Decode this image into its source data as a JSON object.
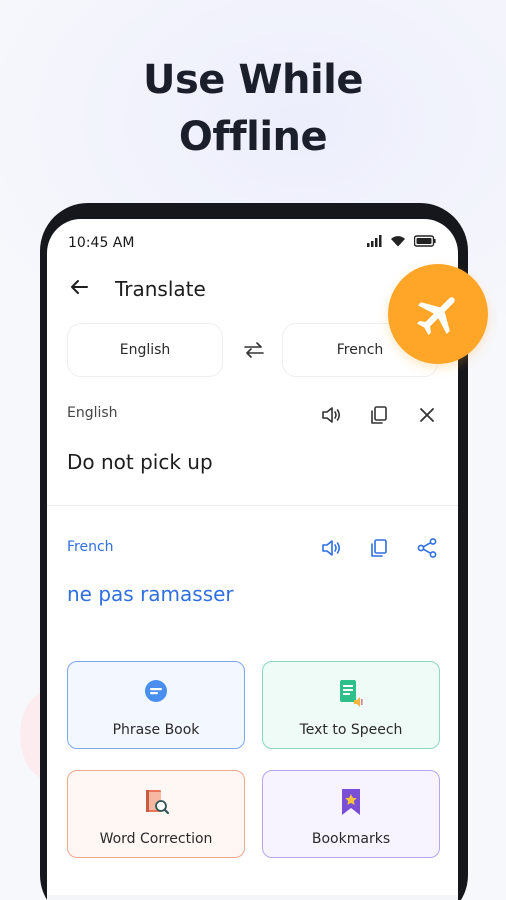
{
  "promo": {
    "headline_line1": "Use While",
    "headline_line2": "Offline"
  },
  "status_bar": {
    "time": "10:45 AM"
  },
  "header": {
    "title": "Translate"
  },
  "languages": {
    "source": "English",
    "target": "French"
  },
  "source_panel": {
    "label": "English",
    "text": "Do not pick up"
  },
  "target_panel": {
    "label": "French",
    "text": "ne pas ramasser"
  },
  "features": [
    {
      "label": "Phrase Book",
      "icon": "chat-bubble-icon"
    },
    {
      "label": "Text to Speech",
      "icon": "document-speaker-icon"
    },
    {
      "label": "Word Correction",
      "icon": "book-magnifier-icon"
    },
    {
      "label": "Bookmarks",
      "icon": "bookmark-star-icon"
    }
  ],
  "colors": {
    "accent_blue": "#2f6fe0",
    "badge_orange": "#ffa629",
    "phrase_border": "#7fa6ec",
    "tts_border": "#8ad7c2",
    "word_border": "#f0a88e",
    "bookmarks_border": "#b5a5ec"
  },
  "badge": {
    "icon": "airplane-icon"
  }
}
